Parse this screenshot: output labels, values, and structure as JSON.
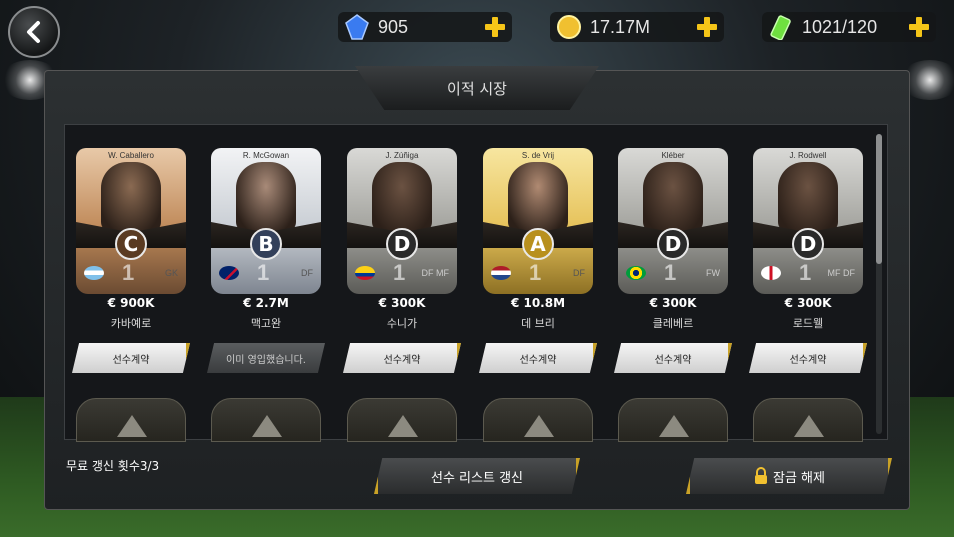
{
  "header": {
    "gems": "905",
    "coins": "17.17M",
    "energy": "1021/120"
  },
  "panel": {
    "title": "이적 시장"
  },
  "players": [
    {
      "card_name": "W. Caballero",
      "grade": "C",
      "number": "1",
      "position": "GK",
      "price": "€ 900K",
      "name": "카바예로",
      "action": "선수계약",
      "tone": "bronze",
      "flag": "argentina"
    },
    {
      "card_name": "R. McGowan",
      "grade": "B",
      "number": "1",
      "position": "DF",
      "price": "€ 2.7M",
      "name": "맥고완",
      "action": "이미 영입했습니다.",
      "tone": "silver",
      "flag": "australia"
    },
    {
      "card_name": "J. Zúñiga",
      "grade": "D",
      "number": "1",
      "position": "DF MF",
      "price": "€ 300K",
      "name": "수니가",
      "action": "선수계약",
      "tone": "grey",
      "flag": "colombia"
    },
    {
      "card_name": "S. de Vrij",
      "grade": "A",
      "number": "1",
      "position": "DF",
      "price": "€ 10.8M",
      "name": "데 브리",
      "action": "선수계약",
      "tone": "gold",
      "flag": "netherlands"
    },
    {
      "card_name": "Kléber",
      "grade": "D",
      "number": "1",
      "position": "FW",
      "price": "€ 300K",
      "name": "클레베르",
      "action": "선수계약",
      "tone": "grey",
      "flag": "brazil"
    },
    {
      "card_name": "J. Rodwell",
      "grade": "D",
      "number": "1",
      "position": "MF DF",
      "price": "€ 300K",
      "name": "로드웰",
      "action": "선수계약",
      "tone": "grey",
      "flag": "england"
    }
  ],
  "footer": {
    "refresh_count": "무료 갱신 횟수3/3",
    "refresh_button": "선수 리스트 갱신",
    "unlock_button": "잠금 해제"
  },
  "colors": {
    "accent": "#f5c518",
    "gold_edge": "#c9a227"
  }
}
